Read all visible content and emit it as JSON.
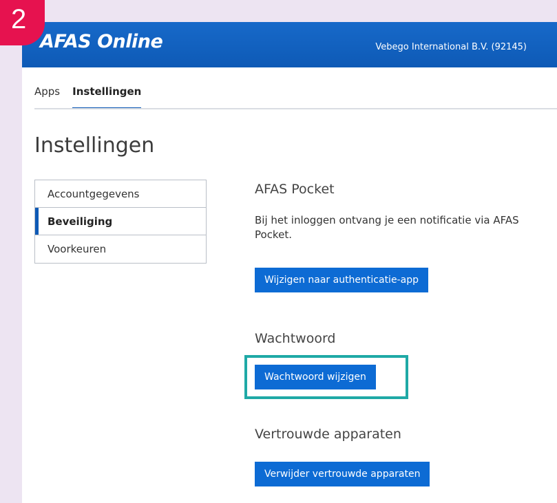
{
  "step_number": "2",
  "header": {
    "logo_text": "AFAS Online",
    "company": "Vebego International B.V. (92145)"
  },
  "tabs": [
    {
      "label": "Apps"
    },
    {
      "label": "Instellingen"
    }
  ],
  "page_title": "Instellingen",
  "side_menu": [
    {
      "label": "Accountgegevens"
    },
    {
      "label": "Beveiliging"
    },
    {
      "label": "Voorkeuren"
    }
  ],
  "sections": {
    "pocket": {
      "title": "AFAS Pocket",
      "text": "Bij het inloggen ontvang je een notificatie via AFAS Pocket.",
      "button": "Wijzigen naar authenticatie-app"
    },
    "password": {
      "title": "Wachtwoord",
      "button": "Wachtwoord wijzigen"
    },
    "devices": {
      "title": "Vertrouwde apparaten",
      "button": "Verwijder vertrouwde apparaten"
    }
  },
  "colors": {
    "brand_blue": "#0e5ab6",
    "button_blue": "#0d6bd4",
    "highlight_teal": "#1fa9a6",
    "badge_pink": "#e6124f",
    "background_lilac": "#ede4f2"
  }
}
